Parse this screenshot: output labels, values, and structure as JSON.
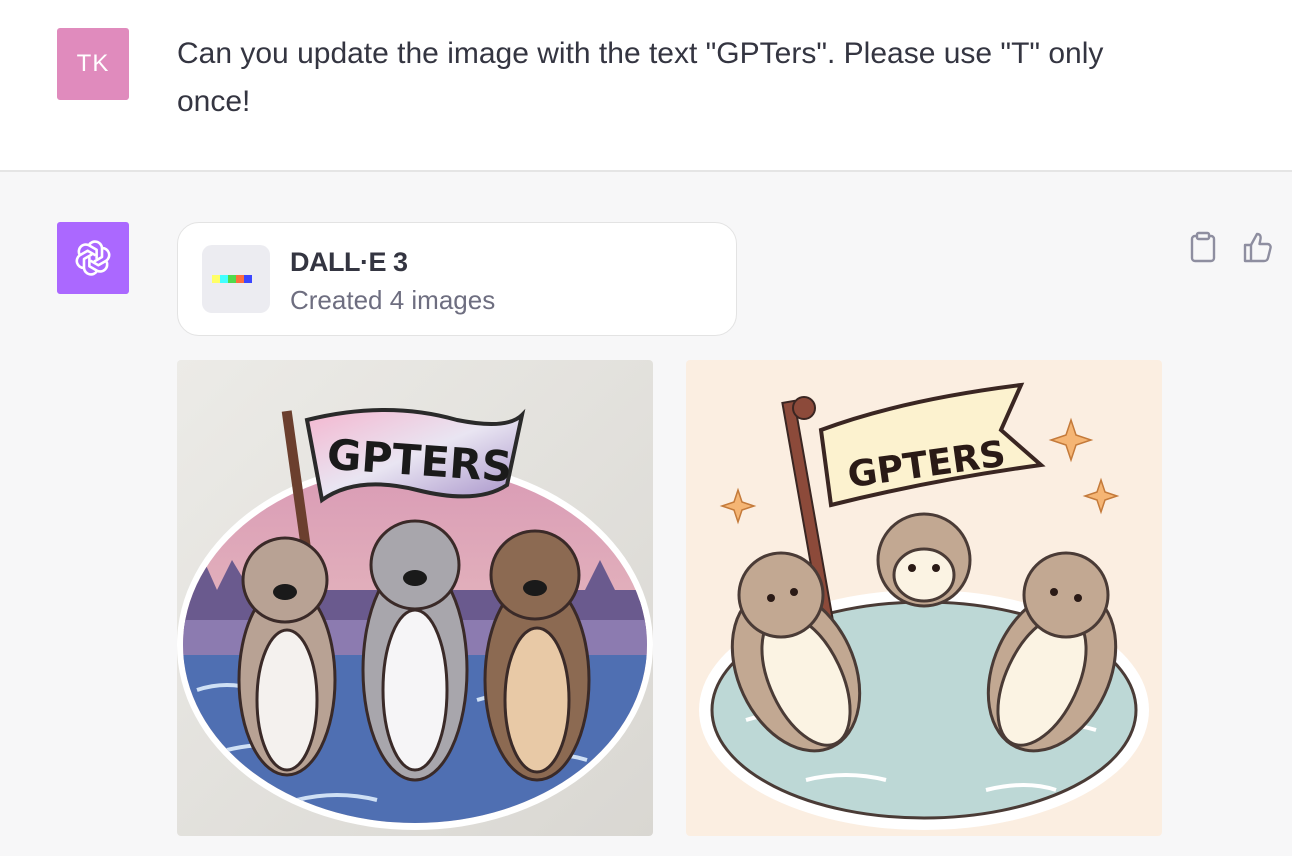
{
  "user": {
    "initials": "TK",
    "message": "Can you update the image with the text \"GPTers\". Please use \"T\" only once!"
  },
  "assistant": {
    "tool": {
      "name": "DALL·E 3",
      "status": "Created 4 images"
    },
    "images": [
      {
        "flag_text": "GPTERS"
      },
      {
        "flag_text": "GPTERS"
      }
    ]
  },
  "icons": {
    "user_avatar": "user-avatar",
    "assistant_avatar": "openai-logo-icon",
    "copy": "clipboard-icon",
    "like": "thumbs-up-icon",
    "tool_thumb": "dalle-thumb-icon"
  },
  "colors": {
    "user_avatar": "#e08bbd",
    "assistant_avatar": "#ab68ff",
    "assistant_bg": "#f7f7f8"
  }
}
